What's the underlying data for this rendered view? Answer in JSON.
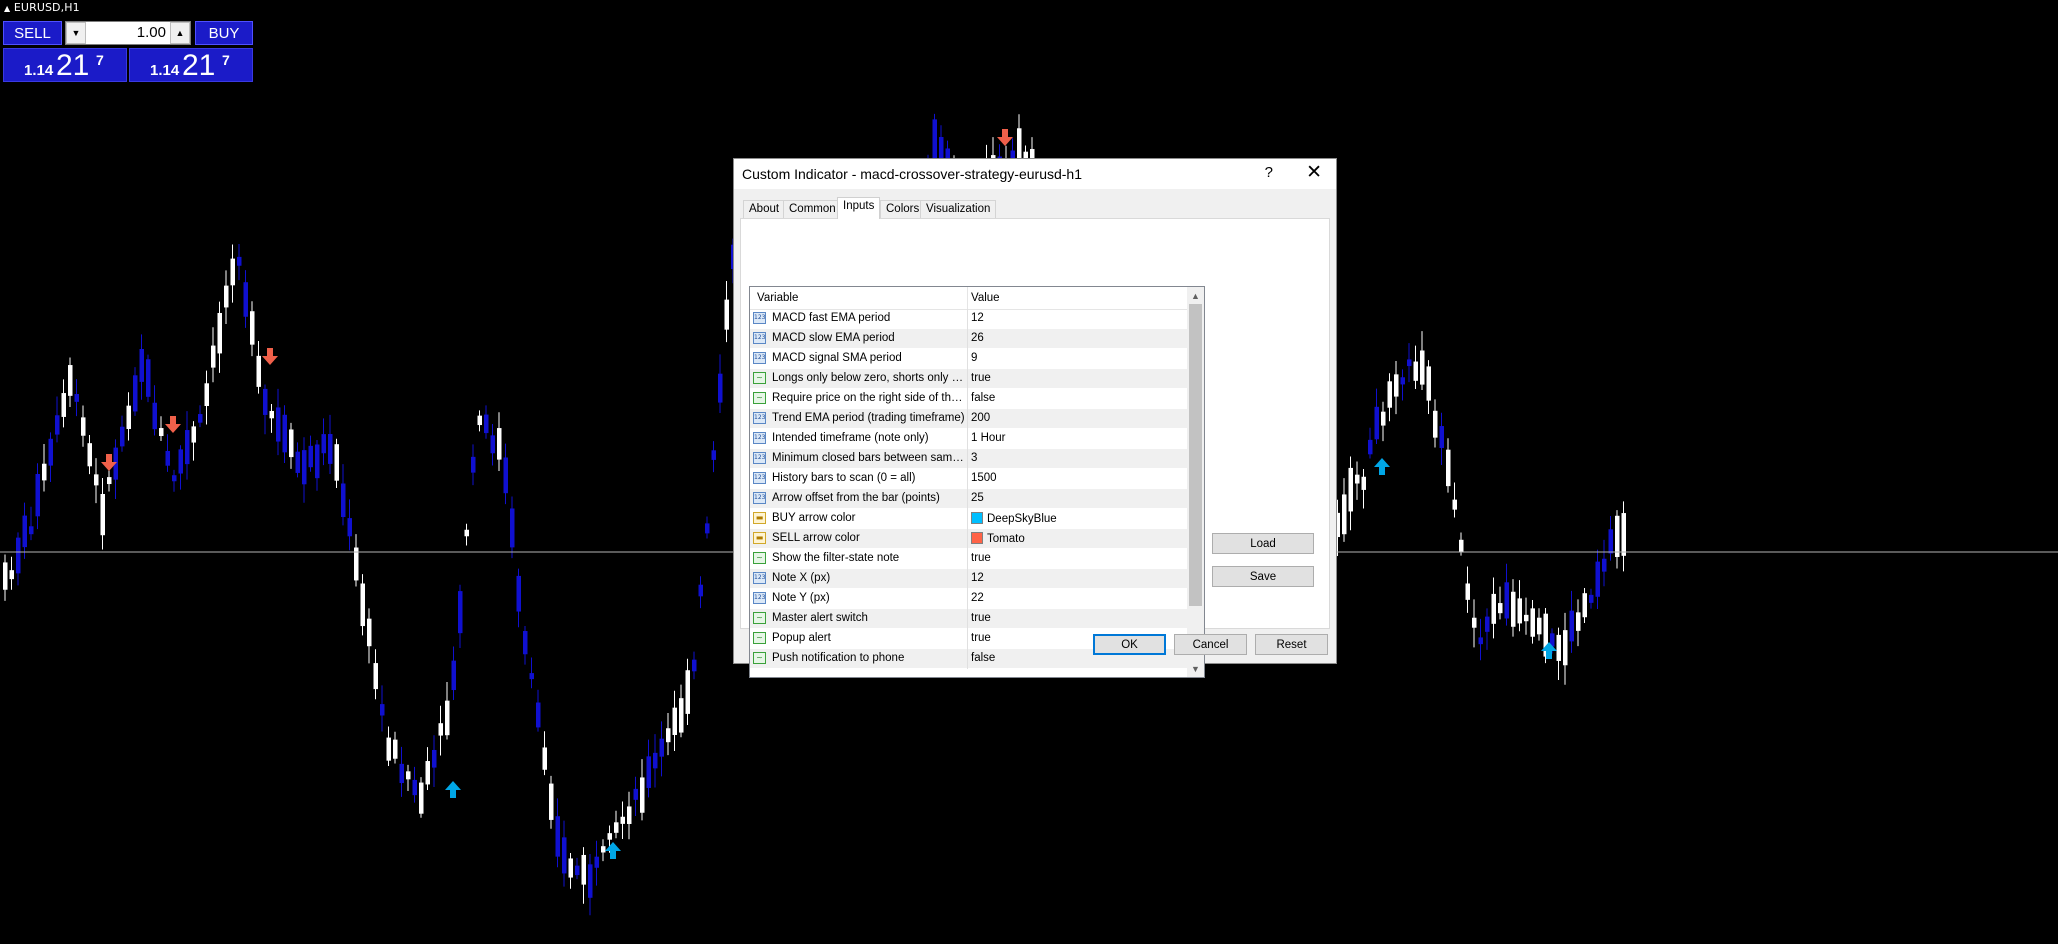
{
  "symbol": {
    "label": "EURUSD,H1",
    "arrow_glyph": "▲"
  },
  "trade_panel": {
    "sell_label": "SELL",
    "buy_label": "BUY",
    "lot_value": "1.00",
    "down_glyph": "▼",
    "up_glyph": "▲",
    "sell_price": {
      "prefix": "1.14",
      "big": "21",
      "sup": "7"
    },
    "buy_price": {
      "prefix": "1.14",
      "big": "21",
      "sup": "7"
    },
    "colors": {
      "panel": "#1b1bc8"
    }
  },
  "chart": {
    "colors": {
      "bear_candle": "#1010d0",
      "bull_candle": "#ffffff",
      "buy_arrow": "#00a6e6",
      "sell_arrow": "#f0604a",
      "price_line": "#b4b4b4"
    }
  },
  "dialog": {
    "title": "Custom Indicator - macd-crossover-strategy-eurusd-h1",
    "help_glyph": "?",
    "close_glyph": "✕",
    "tabs": [
      {
        "label": "About"
      },
      {
        "label": "Common"
      },
      {
        "label": "Inputs",
        "active": true
      },
      {
        "label": "Colors"
      },
      {
        "label": "Visualization"
      }
    ],
    "grid": {
      "col_variable": "Variable",
      "col_value": "Value",
      "rows": [
        {
          "icon": "123",
          "type": "num",
          "variable": "MACD fast EMA period",
          "value": "12"
        },
        {
          "icon": "123",
          "type": "num",
          "variable": "MACD slow EMA period",
          "value": "26"
        },
        {
          "icon": "123",
          "type": "num",
          "variable": "MACD signal SMA period",
          "value": "9"
        },
        {
          "icon": "~",
          "type": "bool",
          "variable": "Longs only below zero, shorts only ab...",
          "value": "true"
        },
        {
          "icon": "~",
          "type": "bool",
          "variable": "Require price on the right side of the ...",
          "value": "false"
        },
        {
          "icon": "123",
          "type": "num",
          "variable": "Trend EMA period (trading timeframe)",
          "value": "200"
        },
        {
          "icon": "123",
          "type": "num",
          "variable": "Intended timeframe (note only)",
          "value": "1 Hour"
        },
        {
          "icon": "123",
          "type": "num",
          "variable": "Minimum closed bars between same-si...",
          "value": "3"
        },
        {
          "icon": "123",
          "type": "num",
          "variable": "History bars to scan (0 = all)",
          "value": "1500"
        },
        {
          "icon": "123",
          "type": "num",
          "variable": "Arrow offset from the bar (points)",
          "value": "25"
        },
        {
          "icon": "▬",
          "type": "color",
          "variable": "BUY arrow color",
          "value": "DeepSkyBlue",
          "swatch": "#00bfff"
        },
        {
          "icon": "▬",
          "type": "color",
          "variable": "SELL arrow color",
          "value": "Tomato",
          "swatch": "#ff6347"
        },
        {
          "icon": "~",
          "type": "bool",
          "variable": "Show the filter-state note",
          "value": "true"
        },
        {
          "icon": "123",
          "type": "num",
          "variable": "Note X (px)",
          "value": "12"
        },
        {
          "icon": "123",
          "type": "num",
          "variable": "Note Y (px)",
          "value": "22"
        },
        {
          "icon": "~",
          "type": "bool",
          "variable": "Master alert switch",
          "value": "true"
        },
        {
          "icon": "~",
          "type": "bool",
          "variable": "Popup alert",
          "value": "true"
        },
        {
          "icon": "~",
          "type": "bool",
          "variable": "Push notification to phone",
          "value": "false"
        }
      ],
      "scroll_up_glyph": "▲",
      "scroll_down_glyph": "▼"
    },
    "buttons": {
      "load": "Load",
      "save": "Save",
      "ok": "OK",
      "cancel": "Cancel",
      "reset": "Reset"
    }
  }
}
